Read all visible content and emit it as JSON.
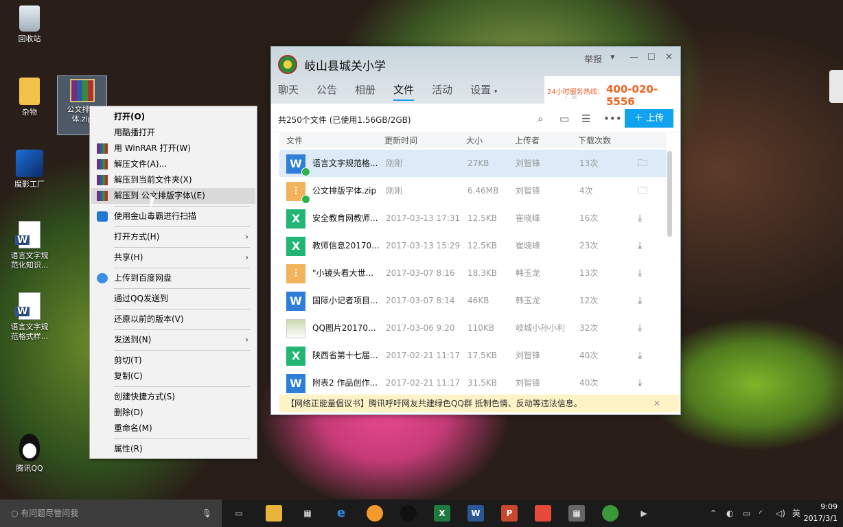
{
  "desktop": {
    "icons": [
      {
        "label": "回收站"
      },
      {
        "label": "杂物"
      },
      {
        "label": "公文排版字体.zip",
        "short": "公文排版\n体.zip"
      },
      {
        "label": "魔影工厂"
      },
      {
        "label": "语言文字规范化知识...",
        "l1": "语言文字规",
        "l2": "范化知识..."
      },
      {
        "label": "语言文字规范格式样...",
        "l1": "语言文字规",
        "l2": "范格式样..."
      },
      {
        "label": "腾讯QQ"
      }
    ]
  },
  "context_menu": {
    "items": [
      {
        "label": "打开(O)"
      },
      {
        "label": "用酷播打开"
      },
      {
        "label": "用 WinRAR 打开(W)"
      },
      {
        "label": "解压文件(A)..."
      },
      {
        "label": "解压到当前文件夹(X)"
      },
      {
        "label": "解压到 公文排版字体\\(E)"
      },
      {
        "label": "使用金山毒霸进行扫描"
      },
      {
        "label": "打开方式(H)"
      },
      {
        "label": "共享(H)"
      },
      {
        "label": "上传到百度网盘"
      },
      {
        "label": "通过QQ发送到"
      },
      {
        "label": "还原以前的版本(V)"
      },
      {
        "label": "发送到(N)"
      },
      {
        "label": "剪切(T)"
      },
      {
        "label": "复制(C)"
      },
      {
        "label": "创建快捷方式(S)"
      },
      {
        "label": "删除(D)"
      },
      {
        "label": "重命名(M)"
      },
      {
        "label": "属性(R)"
      }
    ]
  },
  "qq_window": {
    "title": "岐山县城关小学",
    "report": "举报",
    "tabs": [
      "聊天",
      "公告",
      "相册",
      "文件",
      "活动",
      "设置"
    ],
    "active_tab": "文件",
    "ad": {
      "hotline_label": "24小时服务热线：",
      "hotline": "400-020-5556",
      "tag": "广告"
    },
    "summary": "共250个文件 (已使用1.56GB/2GB)",
    "upload_label": "上传",
    "columns": [
      "文件",
      "更新时间",
      "大小",
      "上传者",
      "下载次数"
    ],
    "files": [
      {
        "name": "语言文字规范格...",
        "time": "刚刚",
        "size": "27KB",
        "uploader": "刘智锋",
        "downloads": "13次",
        "type": "w"
      },
      {
        "name": "公文排版字体.zip",
        "time": "刚刚",
        "size": "6.46MB",
        "uploader": "刘智锋",
        "downloads": "4次",
        "type": "z"
      },
      {
        "name": "安全教育网教师...",
        "time": "2017-03-13 17:31",
        "size": "12.5KB",
        "uploader": "崔晓峰",
        "downloads": "16次",
        "type": "x"
      },
      {
        "name": "教师信息20170...",
        "time": "2017-03-13 15:29",
        "size": "12.5KB",
        "uploader": "崔晓峰",
        "downloads": "23次",
        "type": "x"
      },
      {
        "name": "\"小镜头看大世...",
        "time": "2017-03-07 8:16",
        "size": "18.3KB",
        "uploader": "韩玉龙",
        "downloads": "13次",
        "type": "z"
      },
      {
        "name": "国际小记者项目...",
        "time": "2017-03-07 8:14",
        "size": "46KB",
        "uploader": "韩玉龙",
        "downloads": "12次",
        "type": "w"
      },
      {
        "name": "QQ图片20170...",
        "time": "2017-03-06 9:20",
        "size": "110KB",
        "uploader": "岐城小孙小利",
        "downloads": "32次",
        "type": "img"
      },
      {
        "name": "陕西省第十七届...",
        "time": "2017-02-21 11:17",
        "size": "17.5KB",
        "uploader": "刘智锋",
        "downloads": "40次",
        "type": "x"
      },
      {
        "name": "附表2 作品创作...",
        "time": "2017-02-21 11:17",
        "size": "31.5KB",
        "uploader": "刘智锋",
        "downloads": "40次",
        "type": "w"
      }
    ],
    "notice": "【网络正能量倡议书】腾讯呼吁网友共建绿色QQ群 抵制色情、反动等违法信息。"
  },
  "taskbar": {
    "search_placeholder": "有问题尽管问我",
    "ime": "英",
    "time": "9:09",
    "date": "2017/3/1"
  },
  "colors": {
    "accent": "#12a3f0",
    "selected_row": "#dcebf7",
    "notice_bg": "#fdf3c7"
  }
}
